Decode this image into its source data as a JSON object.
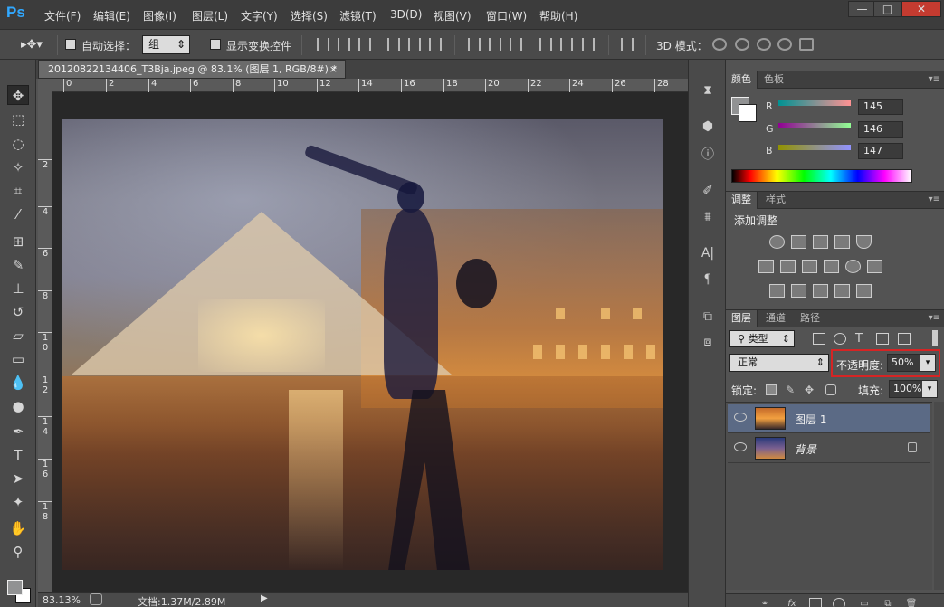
{
  "app": {
    "logo": "Ps"
  },
  "menu": [
    {
      "label": "文件(F)"
    },
    {
      "label": "编辑(E)"
    },
    {
      "label": "图像(I)"
    },
    {
      "label": "图层(L)"
    },
    {
      "label": "文字(Y)"
    },
    {
      "label": "选择(S)"
    },
    {
      "label": "滤镜(T)"
    },
    {
      "label": "3D(D)"
    },
    {
      "label": "视图(V)"
    },
    {
      "label": "窗口(W)"
    },
    {
      "label": "帮助(H)"
    }
  ],
  "window_controls": {
    "minimize": "—",
    "maximize": "□",
    "close": "✕"
  },
  "options": {
    "auto_select_label": "自动选择：",
    "auto_select_value": "组",
    "show_transform_label": "显示变换控件",
    "mode_3d_label": "3D 模式："
  },
  "document": {
    "tab_title": "20120822134406_T3Bja.jpeg @ 83.1% (图层 1, RGB/8#) *",
    "close_glyph": "×",
    "ruler_h": [
      "0",
      "2",
      "4",
      "6",
      "8",
      "10",
      "12",
      "14",
      "16",
      "18",
      "20",
      "22",
      "24",
      "26",
      "28"
    ],
    "ruler_v": [
      "2",
      "4",
      "6",
      "8",
      "1\n0",
      "1\n2",
      "1\n4",
      "1\n6",
      "1\n8"
    ],
    "zoom": "83.13%",
    "doc_size": "文档:1.37M/2.89M"
  },
  "color_panel": {
    "tabs": [
      "颜色",
      "色板"
    ],
    "r_label": "R",
    "g_label": "G",
    "b_label": "B",
    "r_value": "145",
    "g_value": "146",
    "b_value": "147",
    "fg_color": "#919293"
  },
  "adjust_panel": {
    "tabs": [
      "调整",
      "样式"
    ],
    "title": "添加调整"
  },
  "layers_panel": {
    "tabs": [
      "图层",
      "通道",
      "路径"
    ],
    "filter_value": "类型",
    "blend_mode": "正常",
    "opacity_label": "不透明度:",
    "opacity_value": "50%",
    "lock_label": "锁定:",
    "fill_label": "填充:",
    "fill_value": "100%",
    "layers": [
      {
        "name": "图层 1",
        "selected": true
      },
      {
        "name": "背景",
        "selected": false
      }
    ]
  },
  "colors": {
    "highlight_box": "#d62424",
    "selected_layer": "#5b6a85",
    "ps_blue": "#31a8ff"
  }
}
